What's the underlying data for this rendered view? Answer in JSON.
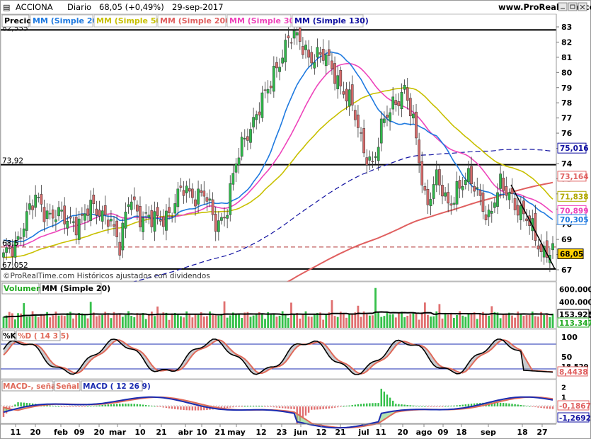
{
  "header": {
    "symbol": "ACCIONA",
    "period": "Diario",
    "price_change": "68,05 (+0,49%)",
    "date": "29-sep-2017",
    "site": "www.ProRealTime.com"
  },
  "price_panel": {
    "label": "Precio",
    "indicators": [
      {
        "label": "MM (Simple 20)",
        "color": "#1f7ae0"
      },
      {
        "label": "MM (Simple 50)",
        "color": "#c8c000"
      },
      {
        "label": "MM (Simple 200)",
        "color": "#e06060"
      },
      {
        "label": "MM (Simple 30)",
        "color": "#ee44bb"
      },
      {
        "label": "MM (Simple 130)",
        "color": "#1010a0"
      }
    ],
    "copyright": "©ProRealTime.com  Históricos ajustados con dividendos",
    "left_labels": [
      "82,555",
      "73,92",
      "68,5",
      "67,052"
    ],
    "badges": [
      {
        "text": "75,016",
        "color": "#1010a0"
      },
      {
        "text": "73,164",
        "color": "#e06060"
      },
      {
        "text": "71,838",
        "color": "#b0a800"
      },
      {
        "text": "70,899",
        "color": "#ee44bb"
      },
      {
        "text": "70,305",
        "color": "#1f7ae0"
      },
      {
        "text": "68,05",
        "color": "#000000"
      }
    ]
  },
  "volume_panel": {
    "label": "Volumen",
    "indicator": "MM (Simple 20)",
    "ticks": [
      "600.000",
      "400.000",
      "200.000"
    ],
    "badges": [
      {
        "text": "153.925",
        "color": "#000000"
      },
      {
        "text": "113.347",
        "color": "#22aa22"
      }
    ]
  },
  "stoch_panel": {
    "labels": [
      "%K",
      "%D ( 14 3 5)"
    ],
    "ticks": [
      "100",
      "50"
    ],
    "partial_tick": "18,529",
    "badges": [
      {
        "text": "8,4438",
        "color": "#e06060"
      }
    ]
  },
  "macd_panel": {
    "labels": [
      "MACD-, señal",
      "Señal",
      "MACD ( 12 26 9)"
    ],
    "ticks": [
      "2",
      "1",
      "0",
      "-1"
    ],
    "badges": [
      {
        "text": "-0,1867",
        "color": "#e06060"
      },
      {
        "text": "-1,2692",
        "color": "#1010a0"
      }
    ]
  },
  "x_axis": {
    "labels": [
      "11",
      "20",
      "feb",
      "09",
      "20",
      "mar",
      "10",
      "21",
      "abr",
      "10",
      "21",
      "may",
      "12",
      "23",
      "jun",
      "12",
      "21",
      "jul",
      "11",
      "20",
      "ago",
      "09",
      "18",
      "sep",
      "18",
      "27"
    ]
  },
  "chart_data": {
    "type": "candlestick",
    "title": "ACCIONA Diario",
    "ylim": [
      67,
      83
    ],
    "yticks": [
      67,
      68,
      69,
      70,
      71,
      72,
      73,
      74,
      75,
      76,
      77,
      78,
      79,
      80,
      81,
      82,
      83
    ],
    "hlines": [
      82.8,
      73.92,
      68.5,
      67.05
    ],
    "close_series": [
      {
        "x": "ene-09",
        "v": 67.6
      },
      {
        "x": "ene-13",
        "v": 68.6
      },
      {
        "x": "ene-18",
        "v": 70.3
      },
      {
        "x": "ene-20",
        "v": 71.5
      },
      {
        "x": "ene-25",
        "v": 70.9
      },
      {
        "x": "ene-30",
        "v": 70.7
      },
      {
        "x": "feb-03",
        "v": 70.0
      },
      {
        "x": "feb-09",
        "v": 70.3
      },
      {
        "x": "feb-14",
        "v": 70.9
      },
      {
        "x": "feb-20",
        "v": 70.7
      },
      {
        "x": "feb-24",
        "v": 70.8
      },
      {
        "x": "mar-01",
        "v": 68.2
      },
      {
        "x": "mar-06",
        "v": 72.2
      },
      {
        "x": "mar-10",
        "v": 70.4
      },
      {
        "x": "mar-15",
        "v": 70.1
      },
      {
        "x": "mar-21",
        "v": 70.6
      },
      {
        "x": "mar-27",
        "v": 70.9
      },
      {
        "x": "abr-03",
        "v": 72.3
      },
      {
        "x": "abr-10",
        "v": 72.1
      },
      {
        "x": "abr-17",
        "v": 71.9
      },
      {
        "x": "abr-21",
        "v": 70.0
      },
      {
        "x": "abr-26",
        "v": 70.8
      },
      {
        "x": "may-03",
        "v": 73.8
      },
      {
        "x": "may-08",
        "v": 76.0
      },
      {
        "x": "may-12",
        "v": 77.5
      },
      {
        "x": "may-17",
        "v": 78.6
      },
      {
        "x": "may-23",
        "v": 80.8
      },
      {
        "x": "may-29",
        "v": 82.3
      },
      {
        "x": "jun-02",
        "v": 82.0
      },
      {
        "x": "jun-07",
        "v": 81.2
      },
      {
        "x": "jun-12",
        "v": 81.0
      },
      {
        "x": "jun-16",
        "v": 80.5
      },
      {
        "x": "jun-21",
        "v": 79.2
      },
      {
        "x": "jun-26",
        "v": 77.6
      },
      {
        "x": "jul-03",
        "v": 75.2
      },
      {
        "x": "jul-07",
        "v": 74.0
      },
      {
        "x": "jul-11",
        "v": 76.6
      },
      {
        "x": "jul-17",
        "v": 78.3
      },
      {
        "x": "jul-20",
        "v": 78.8
      },
      {
        "x": "jul-25",
        "v": 75.8
      },
      {
        "x": "ago-01",
        "v": 71.5
      },
      {
        "x": "ago-04",
        "v": 72.9
      },
      {
        "x": "ago-09",
        "v": 71.2
      },
      {
        "x": "ago-14",
        "v": 72.6
      },
      {
        "x": "ago-18",
        "v": 72.8
      },
      {
        "x": "ago-24",
        "v": 72.1
      },
      {
        "x": "ago-29",
        "v": 70.4
      },
      {
        "x": "sep-05",
        "v": 72.4
      },
      {
        "x": "sep-08",
        "v": 72.2
      },
      {
        "x": "sep-13",
        "v": 70.6
      },
      {
        "x": "sep-18",
        "v": 69.7
      },
      {
        "x": "sep-22",
        "v": 68.4
      },
      {
        "x": "sep-27",
        "v": 68.1
      }
    ]
  }
}
